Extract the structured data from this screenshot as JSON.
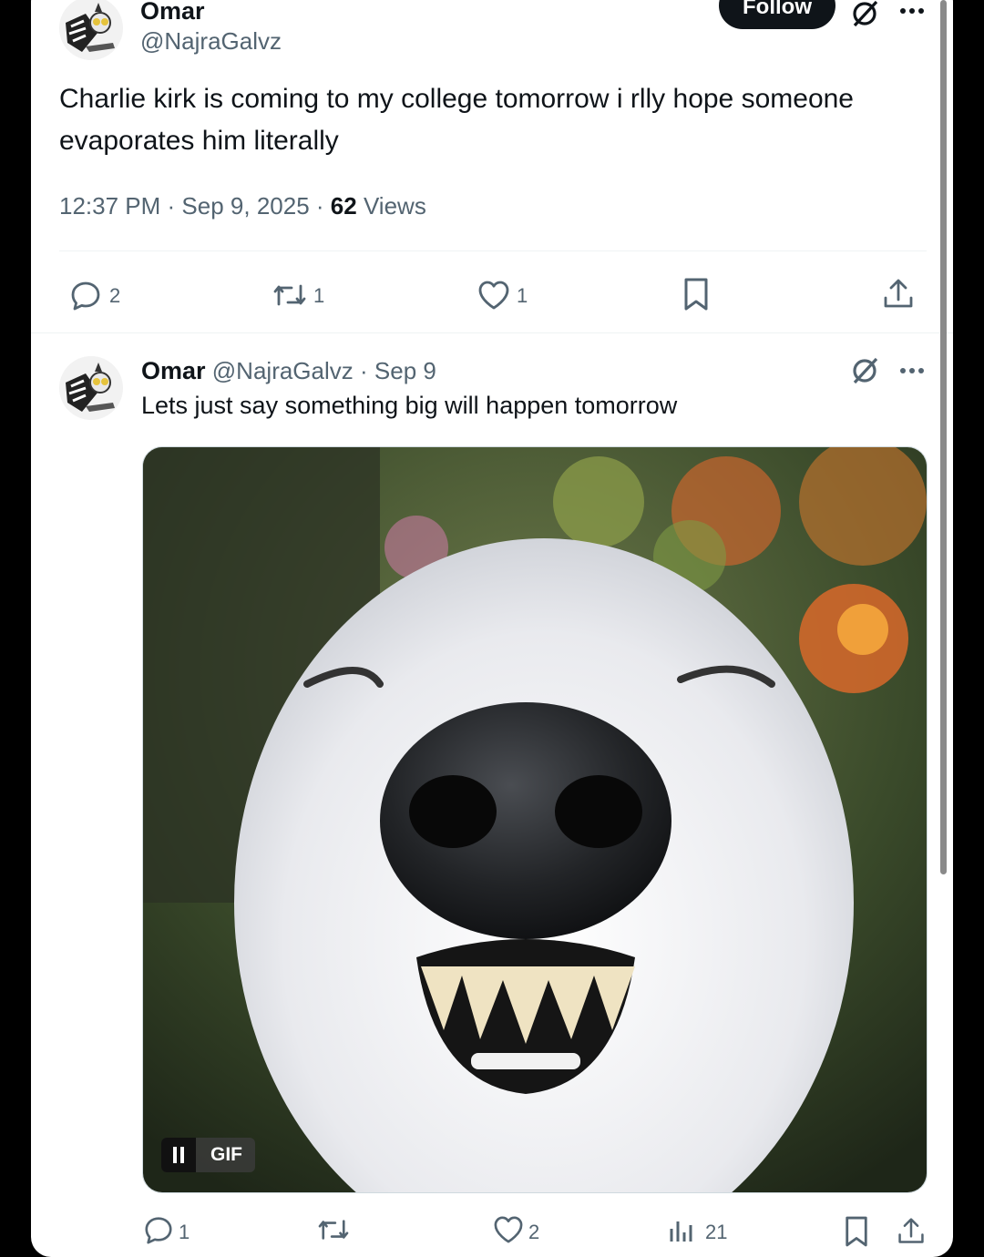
{
  "main_tweet": {
    "author_name": "Omar",
    "author_handle": "@NajraGalvz",
    "follow_label": "Follow",
    "text_line1": "Charlie kirk is coming to my college tomorrow i rlly hope someone",
    "text_line2": "evaporates him literally",
    "time": "12:37 PM",
    "date": "Sep 9, 2025",
    "views_count": "62",
    "views_label": "Views",
    "replies": "2",
    "reposts": "1",
    "likes": "1"
  },
  "reply_tweet": {
    "author_name": "Omar",
    "author_handle": "@NajraGalvz",
    "date": "Sep 9",
    "text": "Lets just say something big will happen tomorrow",
    "gif_label": "GIF",
    "replies": "1",
    "likes": "2",
    "views": "21"
  },
  "icons": [
    "grok-icon",
    "more-icon",
    "reply-icon",
    "repost-icon",
    "like-icon",
    "bookmark-icon",
    "share-icon",
    "views-icon",
    "pause-icon"
  ],
  "colors": {
    "accent": "#0f1419",
    "secondary_text": "#536471",
    "divider": "#eff3f4",
    "background": "#000000"
  }
}
